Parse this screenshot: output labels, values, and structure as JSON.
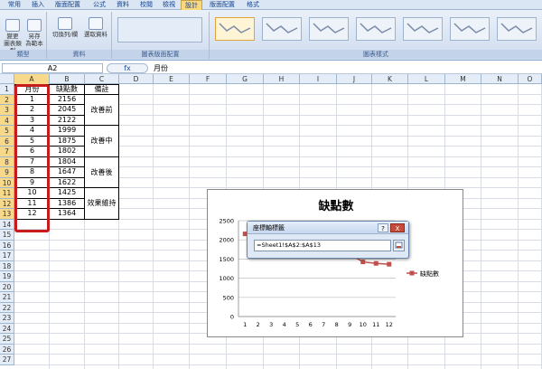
{
  "tabs": [
    "常用",
    "插入",
    "版面配置",
    "公式",
    "資料",
    "校閱",
    "檢視",
    "設計",
    "版面配置",
    "格式"
  ],
  "ribbon": {
    "groups": [
      "類型",
      "資料",
      "圖表版面配置",
      "圖表樣式"
    ],
    "change_type_line1": "變更",
    "change_type_line2": "圖表類型",
    "save_template_line1": "另存",
    "save_template_line2": "為範本",
    "switch_row_col": "切換列/欄",
    "select_data": "選取資料"
  },
  "formula_bar": {
    "name_box": "A2",
    "fx": "fx",
    "content": "月份"
  },
  "columns": [
    "A",
    "B",
    "C",
    "D",
    "E",
    "F",
    "G",
    "H",
    "I",
    "J",
    "K",
    "L",
    "M",
    "N",
    "O"
  ],
  "rows": [
    "1",
    "2",
    "3",
    "4",
    "5",
    "6",
    "7",
    "8",
    "9",
    "10",
    "11",
    "12",
    "13",
    "14",
    "15",
    "16",
    "17",
    "18",
    "19",
    "20",
    "21",
    "22",
    "23",
    "24",
    "25",
    "26",
    "27"
  ],
  "header": {
    "month": "月份",
    "defects": "缺點數",
    "note": "備註"
  },
  "data": {
    "months": [
      "1",
      "2",
      "3",
      "4",
      "5",
      "6",
      "7",
      "8",
      "9",
      "10",
      "11",
      "12"
    ],
    "defects": [
      "2156",
      "2045",
      "2122",
      "1999",
      "1875",
      "1802",
      "1804",
      "1647",
      "1622",
      "1425",
      "1386",
      "1364"
    ],
    "notes": [
      "改善前",
      "改善中",
      "改善後",
      "效果維持"
    ]
  },
  "chart": {
    "title": "缺點數",
    "legend": "缺點數",
    "y_ticks": [
      "2500",
      "2000",
      "1500",
      "1000",
      "500",
      "0"
    ],
    "x_ticks": [
      "1",
      "2",
      "3",
      "4",
      "5",
      "6",
      "7",
      "8",
      "9",
      "10",
      "11",
      "12"
    ],
    "series_color": "#c0504d"
  },
  "chart_data": {
    "type": "line",
    "title": "缺點數",
    "categories": [
      "1",
      "2",
      "3",
      "4",
      "5",
      "6",
      "7",
      "8",
      "9",
      "10",
      "11",
      "12"
    ],
    "series": [
      {
        "name": "缺點數",
        "values": [
          2156,
          2045,
          2122,
          1999,
          1875,
          1802,
          1804,
          1647,
          1622,
          1425,
          1386,
          1364
        ]
      }
    ],
    "ylim": [
      0,
      2500
    ],
    "legend": "right"
  },
  "dialog": {
    "title": "座標軸標籤",
    "value": "=Sheet1!$A$2:$A$13",
    "help": "?",
    "close": "X"
  }
}
